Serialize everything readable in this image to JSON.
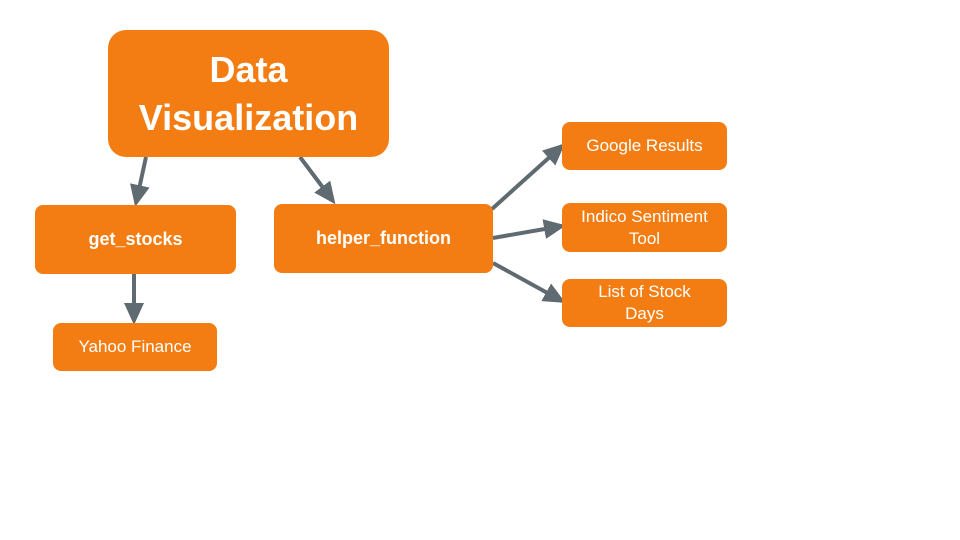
{
  "colors": {
    "node_fill": "#F47D13",
    "node_text": "#FFFFFF",
    "connector": "#5F6B70",
    "background": "#FFFFFF"
  },
  "nodes": {
    "data_visualization": "Data\nVisualization",
    "get_stocks": "get_stocks",
    "helper_function": "helper_function",
    "yahoo_finance": "Yahoo Finance",
    "google_results": "Google Results",
    "indico_sentiment_tool": "Indico Sentiment\nTool",
    "list_of_stock_days": "List of Stock\nDays"
  },
  "edges": [
    {
      "from": "data_visualization",
      "to": "get_stocks"
    },
    {
      "from": "data_visualization",
      "to": "helper_function"
    },
    {
      "from": "get_stocks",
      "to": "yahoo_finance"
    },
    {
      "from": "helper_function",
      "to": "google_results"
    },
    {
      "from": "helper_function",
      "to": "indico_sentiment_tool"
    },
    {
      "from": "helper_function",
      "to": "list_of_stock_days"
    }
  ]
}
